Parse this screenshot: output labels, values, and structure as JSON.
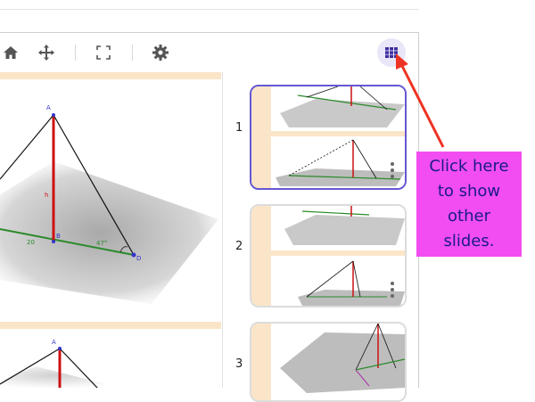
{
  "toolbar": {
    "icons": [
      "home-icon",
      "move-icon",
      "fullscreen-icon",
      "settings-icon",
      "slides-grid-icon"
    ]
  },
  "main_figure": {
    "point_a": "A",
    "point_b": "B",
    "point_d": "D",
    "side_h": "h",
    "side_base": "20",
    "angle": "47°"
  },
  "lower_figure": {
    "point_a": "A",
    "side_h": "h"
  },
  "slides": [
    {
      "number": "1",
      "active": true
    },
    {
      "number": "2",
      "active": false
    },
    {
      "number": "3",
      "active": false
    }
  ],
  "callout": {
    "text": "Click here to show other slides.",
    "color": "#f24df2",
    "arrow_color": "#ee3322"
  },
  "colors": {
    "accent": "#6557d2",
    "grid_button_bg": "#e8e6f8",
    "stripe": "#fbe5c8",
    "height_line": "#cc1111",
    "base_line": "#2a8a2a"
  }
}
